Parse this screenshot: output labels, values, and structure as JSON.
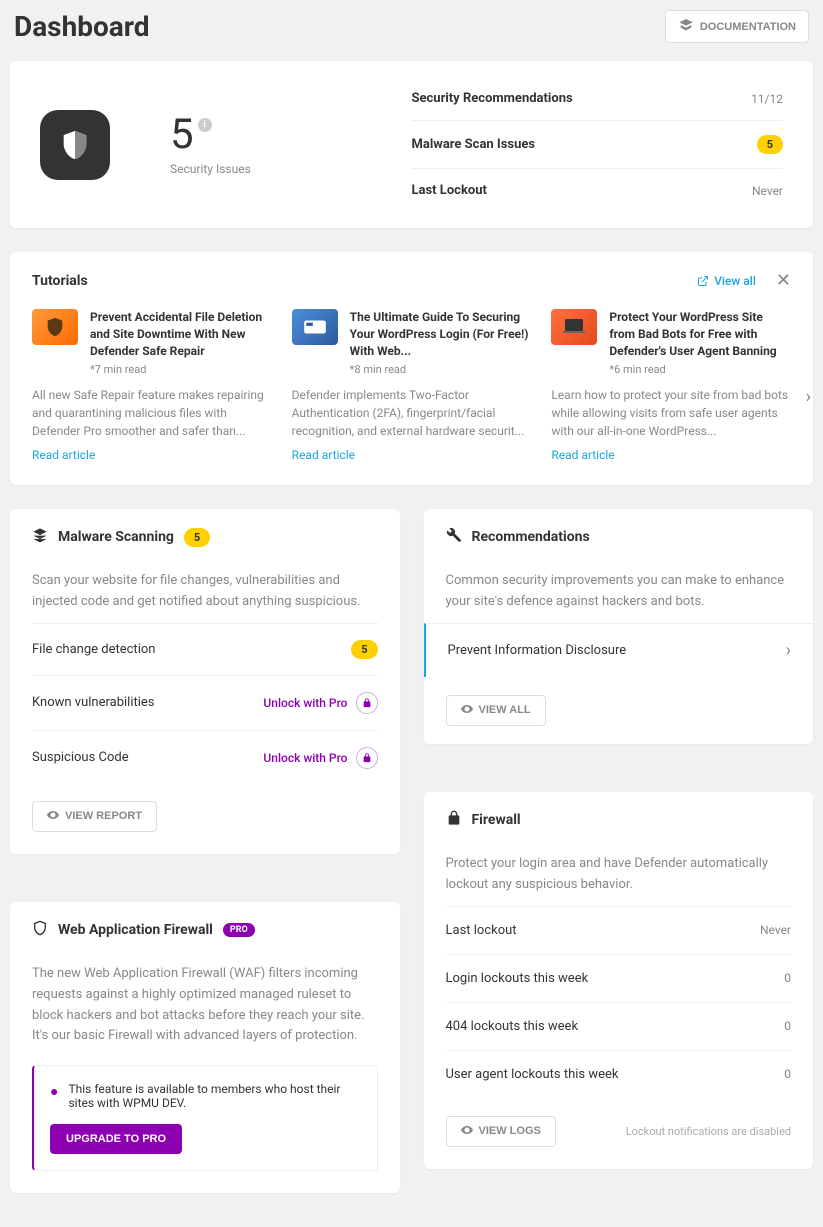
{
  "header": {
    "title": "Dashboard",
    "documentation": "DOCUMENTATION"
  },
  "summary": {
    "count": "5",
    "label": "Security Issues",
    "stats": [
      {
        "label": "Security Recommendations",
        "value": "11/12",
        "pill": false
      },
      {
        "label": "Malware Scan Issues",
        "value": "5",
        "pill": true
      },
      {
        "label": "Last Lockout",
        "value": "Never",
        "pill": false
      }
    ]
  },
  "tutorials": {
    "title": "Tutorials",
    "view_all": "View all",
    "read_article": "Read article",
    "items": [
      {
        "title": "Prevent Accidental File Deletion and Site Downtime With New Defender Safe Repair",
        "meta": "*7 min read",
        "desc": "All new Safe Repair feature makes repairing and quarantining malicious files with Defender Pro smoother and safer than..."
      },
      {
        "title": "The Ultimate Guide To Securing Your WordPress Login (For Free!) With Web...",
        "meta": "*8 min read",
        "desc": "Defender implements Two-Factor Authentication (2FA), fingerprint/facial recognition, and external hardware securit..."
      },
      {
        "title": "Protect Your WordPress Site from Bad Bots for Free with Defender's User Agent Banning",
        "meta": "*6 min read",
        "desc": "Learn how to protect your site from bad bots while allowing visits from safe user agents with our all-in-one WordPress..."
      }
    ]
  },
  "malware": {
    "title": "Malware Scanning",
    "badge": "5",
    "desc": "Scan your website for file changes, vulnerabilities and injected code and get notified about anything suspicious.",
    "rows": {
      "file_change": "File change detection",
      "file_change_count": "5",
      "known_vuln": "Known vulnerabilities",
      "suspicious": "Suspicious Code"
    },
    "unlock": "Unlock with Pro",
    "view_report": "VIEW REPORT"
  },
  "waf": {
    "title": "Web Application Firewall",
    "pro": "PRO",
    "desc": "The new Web Application Firewall (WAF) filters incoming requests against a highly optimized managed ruleset to block hackers and bot attacks before they reach your site. It's our basic Firewall with advanced layers of protection.",
    "notice": "This feature is available to members who host their sites with WPMU DEV.",
    "upgrade": "UPGRADE TO PRO"
  },
  "recommendations": {
    "title": "Recommendations",
    "desc": "Common security improvements you can make to enhance your site's defence against hackers and bots.",
    "row": "Prevent Information Disclosure",
    "view_all": "VIEW ALL"
  },
  "firewall": {
    "title": "Firewall",
    "desc": "Protect your login area and have Defender automatically lockout any suspicious behavior.",
    "rows": [
      {
        "label": "Last lockout",
        "value": "Never"
      },
      {
        "label": "Login lockouts this week",
        "value": "0"
      },
      {
        "label": "404 lockouts this week",
        "value": "0"
      },
      {
        "label": "User agent lockouts this week",
        "value": "0"
      }
    ],
    "view_logs": "VIEW LOGS",
    "note": "Lockout notifications are disabled"
  }
}
